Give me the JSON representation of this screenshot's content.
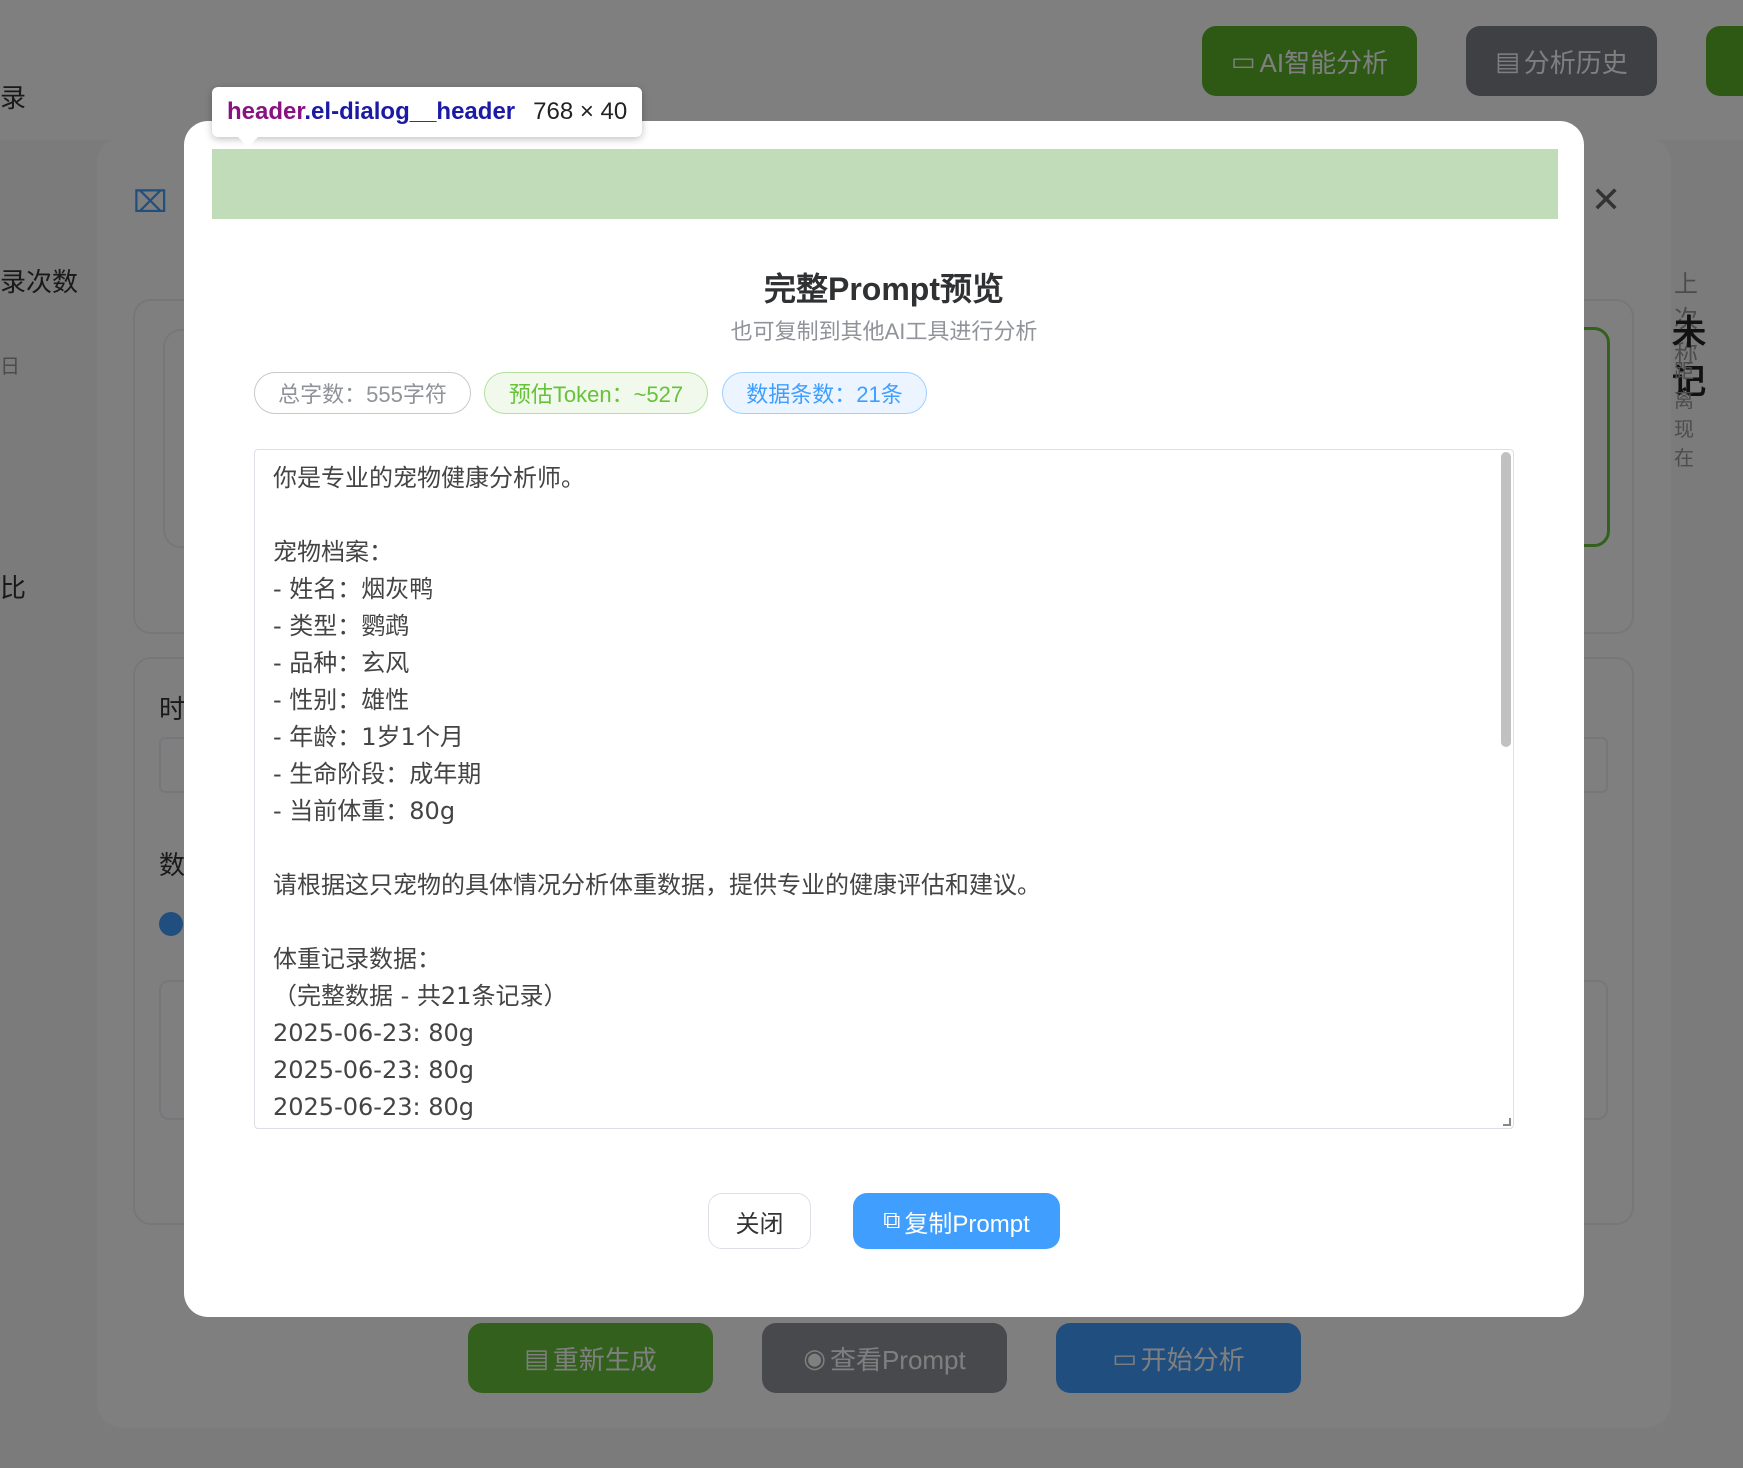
{
  "background": {
    "breadcrumb_fragment": "录",
    "top_buttons": {
      "ai_analysis": "AI智能分析",
      "history": "分析历史"
    },
    "left_fragments": [
      "录次数",
      "日",
      "比"
    ],
    "dialog": {
      "left_fragments": [
        "时",
        "数"
      ],
      "right_label": "上次称",
      "right_value": "未记",
      "right_sub": "距离现在"
    },
    "footer_buttons": {
      "regenerate": "重新生成",
      "view_prompt": "查看Prompt",
      "start_analysis": "开始分析"
    }
  },
  "devtools_tooltip": {
    "tag": "header",
    "class": ".el-dialog__header",
    "size": "768 × 40"
  },
  "preview_dialog": {
    "title": "完整Prompt预览",
    "subtitle": "也可复制到其他AI工具进行分析",
    "stats": {
      "total_chars": "总字数：555字符",
      "estimated_tokens": "预估Token：~527",
      "record_count": "数据条数：21条"
    },
    "prompt_text": "你是专业的宠物健康分析师。\n\n宠物档案：\n- 姓名：烟灰鸭\n- 类型：鹦鹉\n- 品种：玄风\n- 性别：雄性\n- 年龄：1岁1个月\n- 生命阶段：成年期\n- 当前体重：80g\n\n请根据这只宠物的具体情况分析体重数据，提供专业的健康评估和建议。\n\n体重记录数据：\n（完整数据 - 共21条记录）\n2025-06-23: 80g\n2025-06-23: 80g\n2025-06-23: 80g",
    "buttons": {
      "close": "关闭",
      "copy": "复制Prompt"
    }
  },
  "colors": {
    "primary": "#409eff",
    "success": "#67c23a",
    "info": "#909399",
    "header_highlight": "#c1dcb9"
  }
}
